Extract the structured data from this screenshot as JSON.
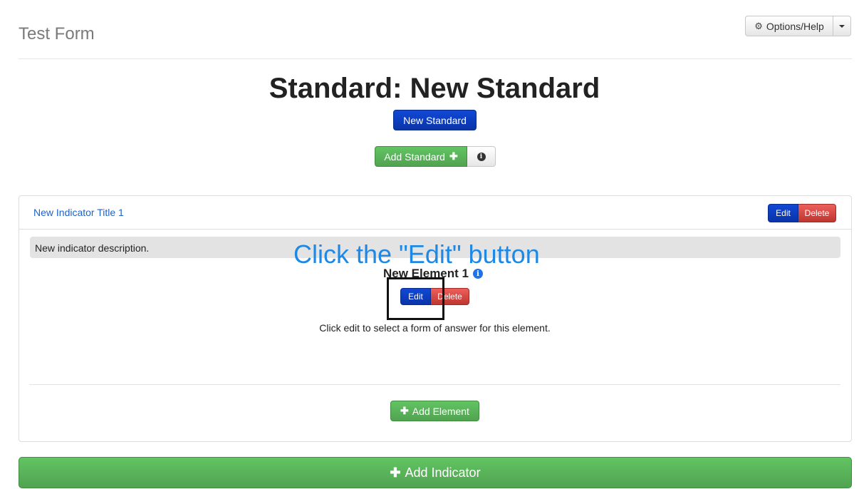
{
  "header": {
    "title": "Test Form",
    "options_label": "Options/Help",
    "options_icon": "gear-icon",
    "caret_icon": "caret-down-icon"
  },
  "standard": {
    "heading": "Standard: New Standard",
    "badge_label": "New Standard",
    "add_standard_label": "Add Standard",
    "plus_icon": "plus-icon",
    "info_icon": "info-icon"
  },
  "indicator": {
    "title": "New Indicator Title 1",
    "edit_label": "Edit",
    "delete_label": "Delete",
    "description": "New indicator description."
  },
  "overlay": {
    "callout_text": "Click the \"Edit\" button"
  },
  "element": {
    "title": "New Element 1",
    "info_icon": "info-circle-icon",
    "edit_label": "Edit",
    "delete_label": "Delete",
    "help_text": "Click edit to select a form of answer for this element."
  },
  "actions": {
    "add_element_label": "Add Element",
    "add_indicator_label": "Add Indicator"
  },
  "colors": {
    "primary_blue": "#0a34a8",
    "success_green": "#51a351",
    "danger_red": "#bd362f",
    "callout_blue": "#1e88e5"
  }
}
